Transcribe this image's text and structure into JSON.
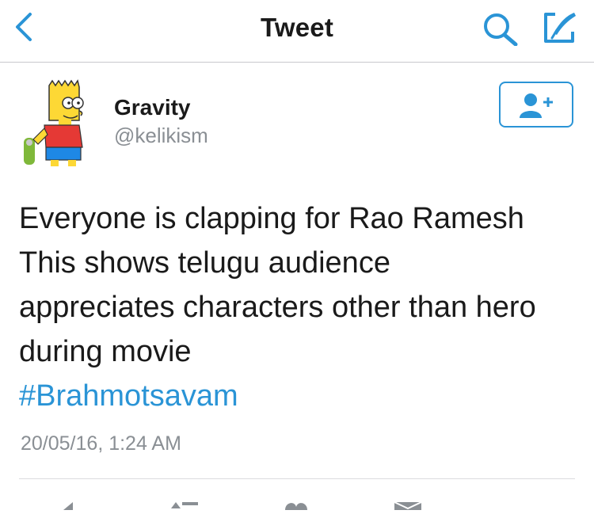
{
  "nav": {
    "title": "Tweet",
    "back_icon": "chevron-left-icon",
    "search_icon": "search-icon",
    "compose_icon": "compose-icon"
  },
  "tweet": {
    "author_name": "Gravity",
    "author_handle": "@kelikism",
    "text_lines": [
      "Everyone is clapping for Rao Ramesh",
      "This shows telugu audience",
      "appreciates characters other than hero",
      "during movie"
    ],
    "hashtag": "#Brahmotsavam",
    "timestamp": "20/05/16, 1:24 AM"
  },
  "colors": {
    "accent": "#2a94d6",
    "secondary_text": "#8a8f94",
    "divider": "#c8c8cc",
    "actions": "#8a8f94"
  },
  "actions": [
    "reply-icon",
    "retweet-icon",
    "like-icon",
    "message-icon"
  ]
}
